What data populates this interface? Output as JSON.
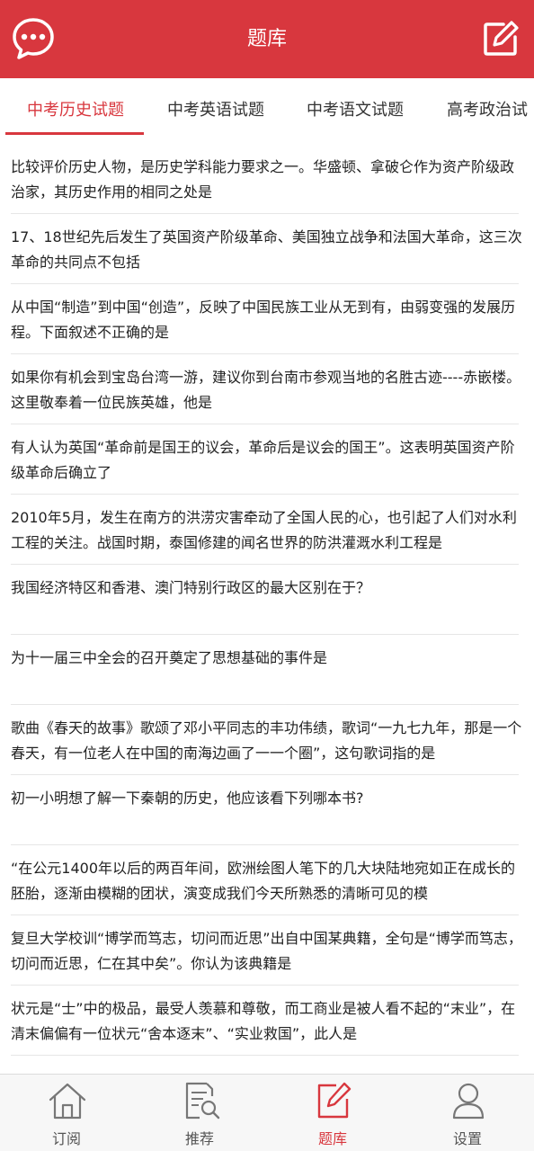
{
  "header": {
    "title": "题库",
    "left_icon": "chat-bubble-icon",
    "right_icon": "edit-icon"
  },
  "tabs": [
    {
      "label": "中考历史试题",
      "active": true
    },
    {
      "label": "中考英语试题",
      "active": false
    },
    {
      "label": "中考语文试题",
      "active": false
    },
    {
      "label": "高考政治试",
      "active": false
    }
  ],
  "questions": [
    "比较评价历史人物，是历史学科能力要求之一。华盛顿、拿破仑作为资产阶级政治家，其历史作用的相同之处是",
    "17、18世纪先后发生了英国资产阶级革命、美国独立战争和法国大革命，这三次革命的共同点不包括",
    "从中国“制造”到中国“创造”，反映了中国民族工业从无到有，由弱变强的发展历程。下面叙述不正确的是",
    "如果你有机会到宝岛台湾一游，建议你到台南市参观当地的名胜古迹----赤嵌楼。这里敬奉着一位民族英雄，他是",
    "有人认为英国“革命前是国王的议会，革命后是议会的国王”。这表明英国资产阶级革命后确立了",
    "2010年5月，发生在南方的洪涝灾害牵动了全国人民的心，也引起了人们对水利工程的关注。战国时期，泰国修建的闻名世界的防洪灌溉水利工程是",
    "我国经济特区和香港、澳门特别行政区的最大区别在于？",
    "为十一届三中全会的召开奠定了思想基础的事件是",
    "歌曲《春天的故事》歌颂了邓小平同志的丰功伟绩，歌词“一九七九年，那是一个春天，有一位老人在中国的南海边画了一一个圈”，这句歌词指的是",
    "初一小明想了解一下秦朝的历史，他应该看下列哪本书?",
    "“在公元1400年以后的两百年间，欧洲绘图人笔下的几大块陆地宛如正在成长的胚胎，逐渐由模糊的团状，演变成我们今天所熟悉的清晰可见的模",
    "复旦大学校训“博学而笃志，切问而近思”出自中国某典籍，全句是“博学而笃志，切问而近思，仁在其中矣”。你认为该典籍是",
    "状元是“士”中的极品，最受人羡慕和尊敬，而工商业是被人看不起的“末业”，在清末偏偏有一位状元“舍本逐末”、“实业救国”，此人是"
  ],
  "bottom_nav": [
    {
      "label": "订阅",
      "icon": "home-icon",
      "active": false
    },
    {
      "label": "推荐",
      "icon": "document-search-icon",
      "active": false
    },
    {
      "label": "题库",
      "icon": "edit-icon",
      "active": true
    },
    {
      "label": "设置",
      "icon": "user-icon",
      "active": false
    }
  ],
  "colors": {
    "accent": "#d8373e",
    "nav_inactive": "#555555"
  }
}
